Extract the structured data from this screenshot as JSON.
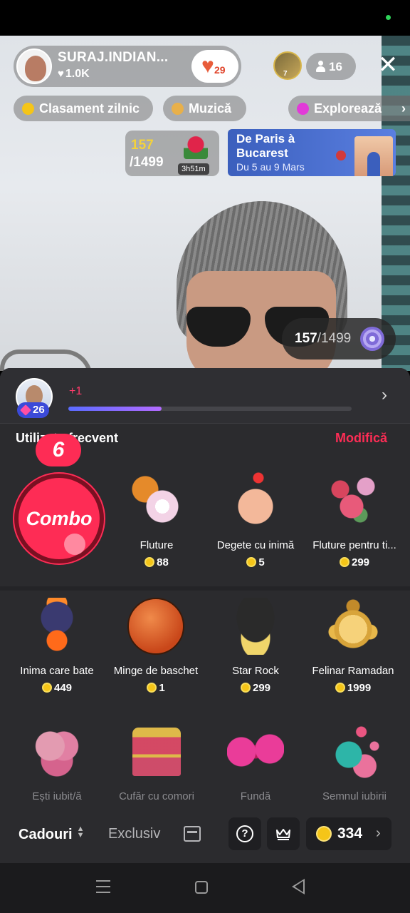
{
  "host": {
    "name": "SURAJ.INDIAN...",
    "likes": "1.0K",
    "fan_club_count": "29"
  },
  "viewers": {
    "top_viewer_badge": "7",
    "count": "16"
  },
  "chips": [
    {
      "label": "Clasament zilnic",
      "color": "#f5c518"
    },
    {
      "label": "Muzică",
      "color": "#e8b04a"
    },
    {
      "label": "Explorează",
      "color": "#e23ad8"
    }
  ],
  "goal_card": {
    "current": "157",
    "target": "/1499",
    "timer": "3h51m",
    "icon": "rose-icon"
  },
  "promo": {
    "title": "De Paris à Bucarest",
    "subtitle": "Du 5 au 9 Mars"
  },
  "goal_progress": {
    "current": "157",
    "target": "/1499",
    "icon": "target-icon"
  },
  "level": {
    "value": "26",
    "gain": "+1",
    "progress": 0.33
  },
  "gift_section": {
    "title": "Utilizate frecvent",
    "edit_label": "Modifică",
    "combo_count": "6",
    "combo_label": "Combo"
  },
  "gifts": [
    {
      "name": "Fluture",
      "price": "88",
      "icon": "butterfly-flower-icon"
    },
    {
      "name": "Degete cu inimă",
      "price": "5",
      "icon": "finger-heart-icon"
    },
    {
      "name": "Fluture pentru ti...",
      "price": "299",
      "icon": "butterfly-flowers-icon"
    },
    {
      "name": "Inima care bate",
      "price": "449",
      "icon": "beating-heart-icon"
    },
    {
      "name": "Minge de baschet",
      "price": "1",
      "icon": "basketball-icon"
    },
    {
      "name": "Star Rock",
      "price": "299",
      "icon": "star-rock-icon"
    },
    {
      "name": "Felinar Ramadan",
      "price": "1999",
      "icon": "ramadan-lantern-icon"
    },
    {
      "name": "Ești iubit/ă",
      "icon": "heart-3d-icon"
    },
    {
      "name": "Cufăr cu comori",
      "icon": "treasure-chest-icon"
    },
    {
      "name": "Fundă",
      "icon": "bow-icon"
    },
    {
      "name": "Semnul iubirii",
      "icon": "love-sign-icon"
    }
  ],
  "tabs": {
    "gifts": "Cadouri",
    "exclusive": "Exclusiv"
  },
  "balance": "334",
  "colors": {
    "accent": "#fe2c55",
    "panel": "#2b2b2e",
    "coin": "#f5c518"
  }
}
